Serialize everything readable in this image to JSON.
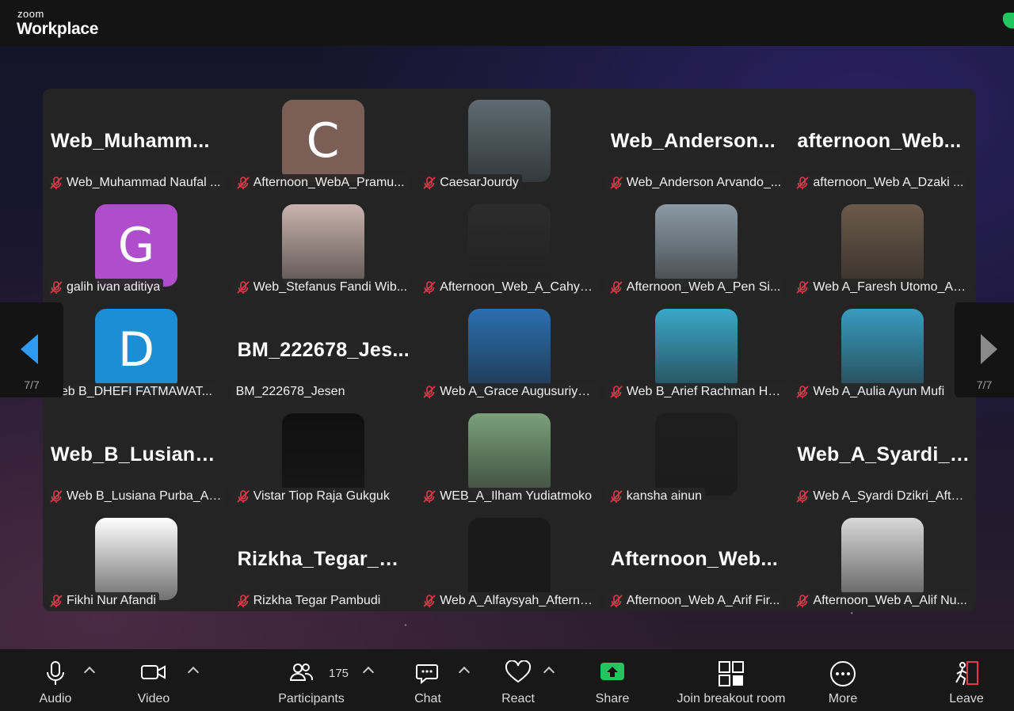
{
  "app": {
    "brand_small": "zoom",
    "brand_big": "Workplace"
  },
  "nav": {
    "page_left": "7/7",
    "page_right": "7/7"
  },
  "participants": [
    {
      "bigname": "Web_Muhamm...",
      "tag": "Web_Muhammad Naufal ...",
      "muted": true
    },
    {
      "initial": "C",
      "color": "#7b5e55",
      "tag": "Afternoon_WebA_Pramu...",
      "muted": true
    },
    {
      "photo": "photo",
      "tag": "CaesarJourdy",
      "muted": true
    },
    {
      "bigname": "Web_Anderson...",
      "tag": "Web_Anderson Arvando_...",
      "muted": true
    },
    {
      "bigname": "afternoon_Web...",
      "tag": "afternoon_Web A_Dzaki ...",
      "muted": true
    },
    {
      "initial": "G",
      "color": "#b04dcc",
      "tag": "galih ivan aditiya",
      "muted": true
    },
    {
      "photo": "photo",
      "tag": "Web_Stefanus Fandi Wib...",
      "muted": true
    },
    {
      "photo": "photo",
      "tag": "Afternoon_Web_A_Cahyo...",
      "muted": true
    },
    {
      "photo": "photo",
      "tag": "Afternoon_Web A_Pen Si...",
      "muted": true
    },
    {
      "photo": "photo",
      "tag": "Web A_Faresh Utomo_Aft...",
      "muted": true
    },
    {
      "initial": "D",
      "color": "#1c8ed6",
      "tag": "Web B_DHEFI FATMAWAT...",
      "muted": false
    },
    {
      "bigname": "BM_222678_Jes...",
      "tag": "BM_222678_Jesen",
      "muted": false
    },
    {
      "photo": "photo",
      "tag": "Web A_Grace Augusuriya...",
      "muted": true
    },
    {
      "photo": "photo",
      "tag": "Web B_Arief Rachman Ha...",
      "muted": true
    },
    {
      "photo": "photo",
      "tag": "Web A_Aulia Ayun Mufi",
      "muted": true
    },
    {
      "bigname": "Web_B_Lusiana...",
      "tag": "Web B_Lusiana Purba_Aft...",
      "muted": true
    },
    {
      "photo": "photo",
      "tag": "Vistar Tiop Raja Gukguk",
      "muted": true
    },
    {
      "photo": "photo",
      "tag": "WEB_A_Ilham Yudiatmoko",
      "muted": true
    },
    {
      "photo": "photo",
      "tag": "kansha ainun",
      "muted": true
    },
    {
      "bigname": "Web_A_Syardi_D...",
      "tag": "Web A_Syardi Dzikri_Afte...",
      "muted": true
    },
    {
      "photo": "photo",
      "tag": "Fikhi Nur Afandi",
      "muted": true
    },
    {
      "bigname": "Rizkha_Tegar_Pa...",
      "tag": "Rizkha Tegar Pambudi",
      "muted": true
    },
    {
      "photo": "photo",
      "tag": "Web A_Alfaysyah_Afterno...",
      "muted": true
    },
    {
      "bigname": "Afternoon_Web...",
      "tag": "Afternoon_Web A_Arif Fir...",
      "muted": true
    },
    {
      "photo": "photo",
      "tag": "Afternoon_Web A_Alif Nu...",
      "muted": true
    }
  ],
  "toolbar": {
    "audio": "Audio",
    "video": "Video",
    "participants": "Participants",
    "participants_count": "175",
    "chat": "Chat",
    "react": "React",
    "share": "Share",
    "breakout": "Join breakout room",
    "more": "More",
    "leave": "Leave"
  },
  "colors": {
    "accent": "#2e9bf0",
    "share": "#23c55e",
    "muted": "#e0394a"
  }
}
